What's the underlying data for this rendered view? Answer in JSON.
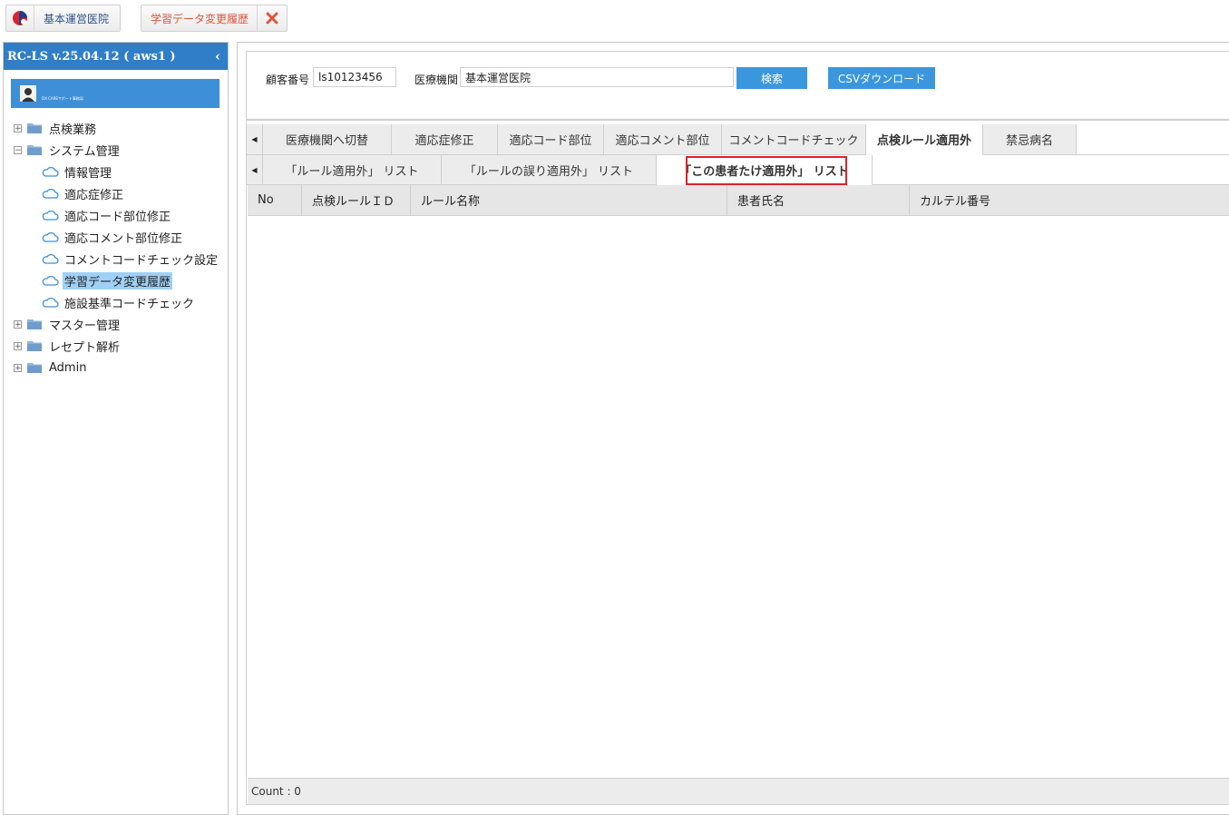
{
  "top_tabs": {
    "home_label": "基本運営医院",
    "history_label": "学習データ変更履歴"
  },
  "sidebar": {
    "title": "RC-LS v.25.04.12 ( aws1 )",
    "user_caption": "DX CAREサポート事務局",
    "tree": [
      {
        "label": "点検業務",
        "type": "folder",
        "expander": "+"
      },
      {
        "label": "システム管理",
        "type": "folder",
        "expander": "−"
      },
      {
        "label": "情報管理",
        "type": "leaf"
      },
      {
        "label": "適応症修正",
        "type": "leaf"
      },
      {
        "label": "適応コード部位修正",
        "type": "leaf"
      },
      {
        "label": "適応コメント部位修正",
        "type": "leaf"
      },
      {
        "label": "コメントコードチェック設定",
        "type": "leaf"
      },
      {
        "label": "学習データ変更履歴",
        "type": "leaf",
        "selected": true
      },
      {
        "label": "施設基準コードチェック",
        "type": "leaf"
      },
      {
        "label": "マスター管理",
        "type": "folder",
        "expander": "+"
      },
      {
        "label": "レセプト解析",
        "type": "folder",
        "expander": "+"
      },
      {
        "label": "Admin",
        "type": "folder",
        "expander": "+"
      }
    ]
  },
  "search": {
    "customer_label": "顧客番号",
    "customer_value": "ls10123456",
    "institution_label": "医療機関",
    "institution_value": "基本運営医院",
    "search_button": "検索",
    "csv_button": "CSVダウンロード"
  },
  "tabs": [
    {
      "label": "医療機関へ切替"
    },
    {
      "label": "適応症修正"
    },
    {
      "label": "適応コード部位"
    },
    {
      "label": "適応コメント部位"
    },
    {
      "label": "コメントコードチェック"
    },
    {
      "label": "点検ルール適用外",
      "active": true
    },
    {
      "label": "禁忌病名"
    }
  ],
  "subtabs": [
    {
      "label": "「ルール適用外」 リスト"
    },
    {
      "label": "「ルールの誤り適用外」 リスト"
    },
    {
      "label": "「この患者たけ適用外」 リスト",
      "active": true
    }
  ],
  "grid": {
    "columns": [
      "No",
      "点検ルールＩＤ",
      "ルール名称",
      "患者氏名",
      "カルテル番号"
    ],
    "rows": [],
    "footer": "Count : 0"
  },
  "colors": {
    "accent": "#2f7ec7",
    "button": "#3a97dd",
    "selected": "#9fd0f5",
    "highlight": "#e0202a"
  }
}
